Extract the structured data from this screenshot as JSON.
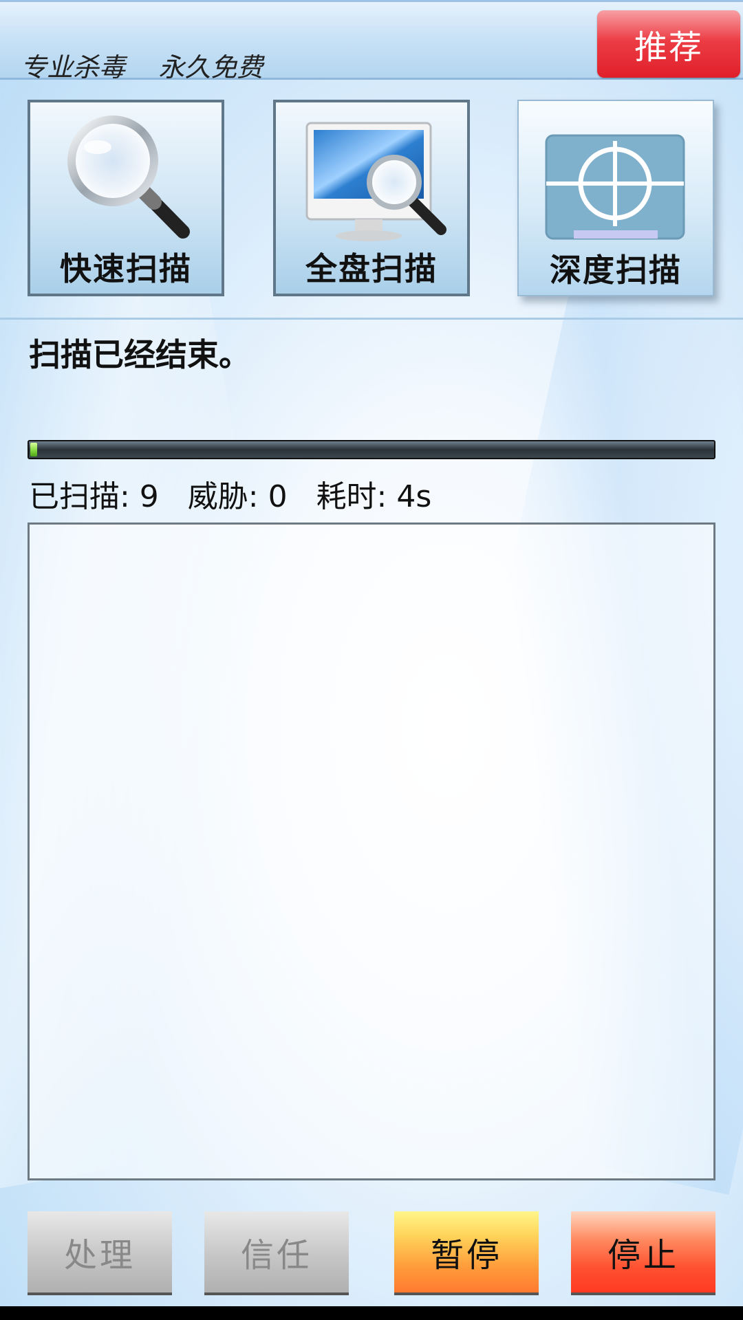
{
  "header": {
    "slogan": "专业杀毒    永久免费",
    "recommend_label": "推荐"
  },
  "scan_buttons": [
    {
      "label": "快速扫描",
      "icon": "magnifier-icon"
    },
    {
      "label": "全盘扫描",
      "icon": "computer-magnifier-icon"
    },
    {
      "label": "深度扫描",
      "icon": "crosshair-target-icon"
    }
  ],
  "status": {
    "message": "扫描已经结束。",
    "progress_fraction": 0.01
  },
  "stats": {
    "scanned": "已扫描: 9",
    "threats": "威胁: 0",
    "elapsed": "耗时: 4s"
  },
  "actions": {
    "handle_label": "处理",
    "trust_label": "信任",
    "pause_label": "暂停",
    "stop_label": "停止"
  },
  "colors": {
    "recommend": "#e0202b",
    "pause": "#ff9a3a",
    "stop": "#ff3a22",
    "progress_fill": "#7ed33a"
  }
}
